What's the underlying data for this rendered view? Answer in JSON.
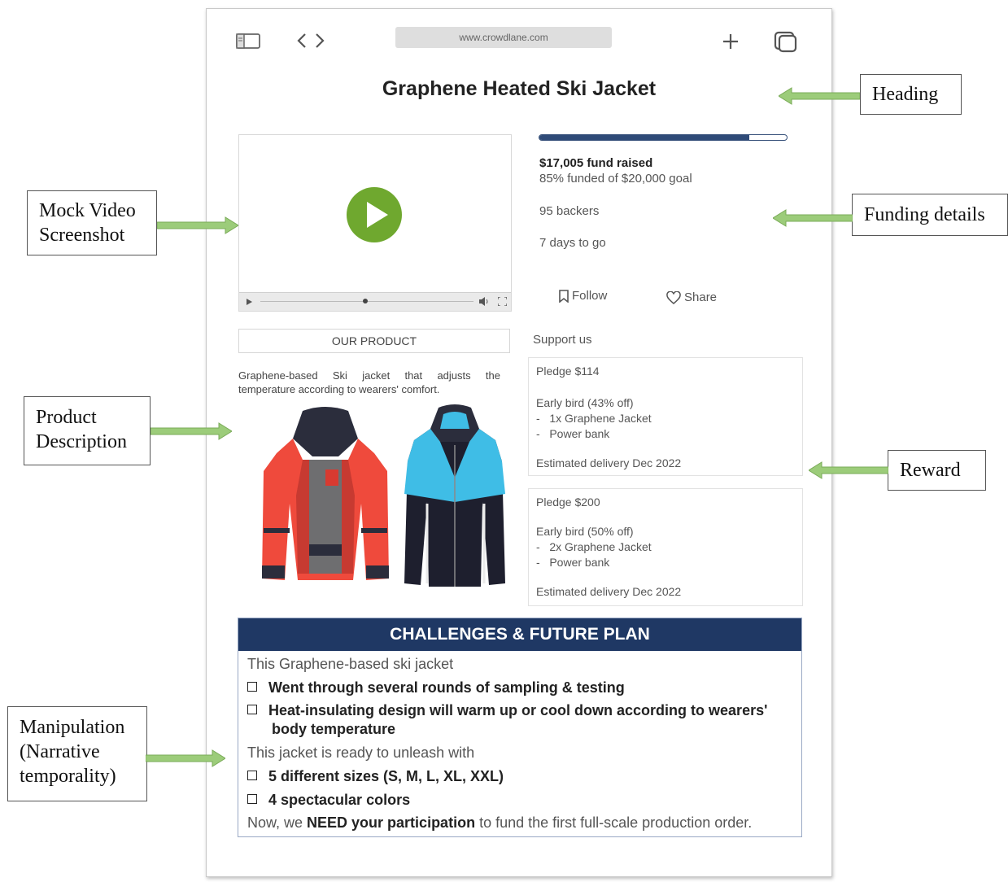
{
  "browser": {
    "url": "www.crowdlane.com",
    "icons": [
      "sidebar-icon",
      "back-icon",
      "forward-icon",
      "new-tab-icon",
      "tabs-icon"
    ]
  },
  "heading": "Graphene Heated Ski Jacket",
  "funding": {
    "progress_percent": 85,
    "raised": "$17,005 fund raised",
    "goal": "85% funded of $20,000 goal",
    "backers": "95 backers",
    "days": "7 days to go",
    "follow": "Follow",
    "share": "Share"
  },
  "product": {
    "section_label": "OUR PRODUCT",
    "description": "Graphene-based Ski jacket that adjusts the temperature according to wearers' comfort.",
    "colors": {
      "jacket1_shell": "#ef4a3c",
      "jacket1_lining": "#6e6e70",
      "jacket2_top": "#3fbde6",
      "jacket2_body": "#1e1f2e"
    }
  },
  "support": {
    "title": "Support us",
    "pledges": [
      {
        "title": "Pledge $114",
        "offer": "Early bird (43% off)",
        "items": [
          "1x Graphene Jacket",
          "Power bank"
        ],
        "delivery": "Estimated delivery Dec 2022"
      },
      {
        "title": "Pledge $200",
        "offer": "Early bird (50% off)",
        "items": [
          "2x Graphene Jacket",
          "Power bank"
        ],
        "delivery": "Estimated delivery Dec 2022"
      }
    ]
  },
  "challenges": {
    "header": "CHALLENGES & FUTURE PLAN",
    "intro1": "This Graphene-based ski jacket",
    "bullets1": [
      "Went through several rounds of sampling & testing",
      "Heat-insulating design will warm up or cool down according to wearers'",
      "body temperature"
    ],
    "intro2": "This jacket is ready to unleash with",
    "bullets2": [
      "5 different sizes (S, M, L, XL, XXL)",
      "4 spectacular colors"
    ],
    "closing_pre": "Now, we ",
    "closing_bold": "NEED your participation",
    "closing_post": " to fund the first full-scale production order."
  },
  "annotations": {
    "heading": "Heading",
    "mock_video_1": "Mock Video",
    "mock_video_2": "Screenshot",
    "funding_details": "Funding details",
    "product_description_1": "Product",
    "product_description_2": "Description",
    "reward": "Reward",
    "manipulation_1": "Manipulation",
    "manipulation_2": "(Narrative",
    "manipulation_3": "temporality)"
  },
  "colors": {
    "arrow": "#9ccc7a",
    "arrow_stroke": "#7aab58",
    "play": "#6fa82f",
    "header_navy": "#1f3864",
    "progress": "#2f4b78"
  }
}
